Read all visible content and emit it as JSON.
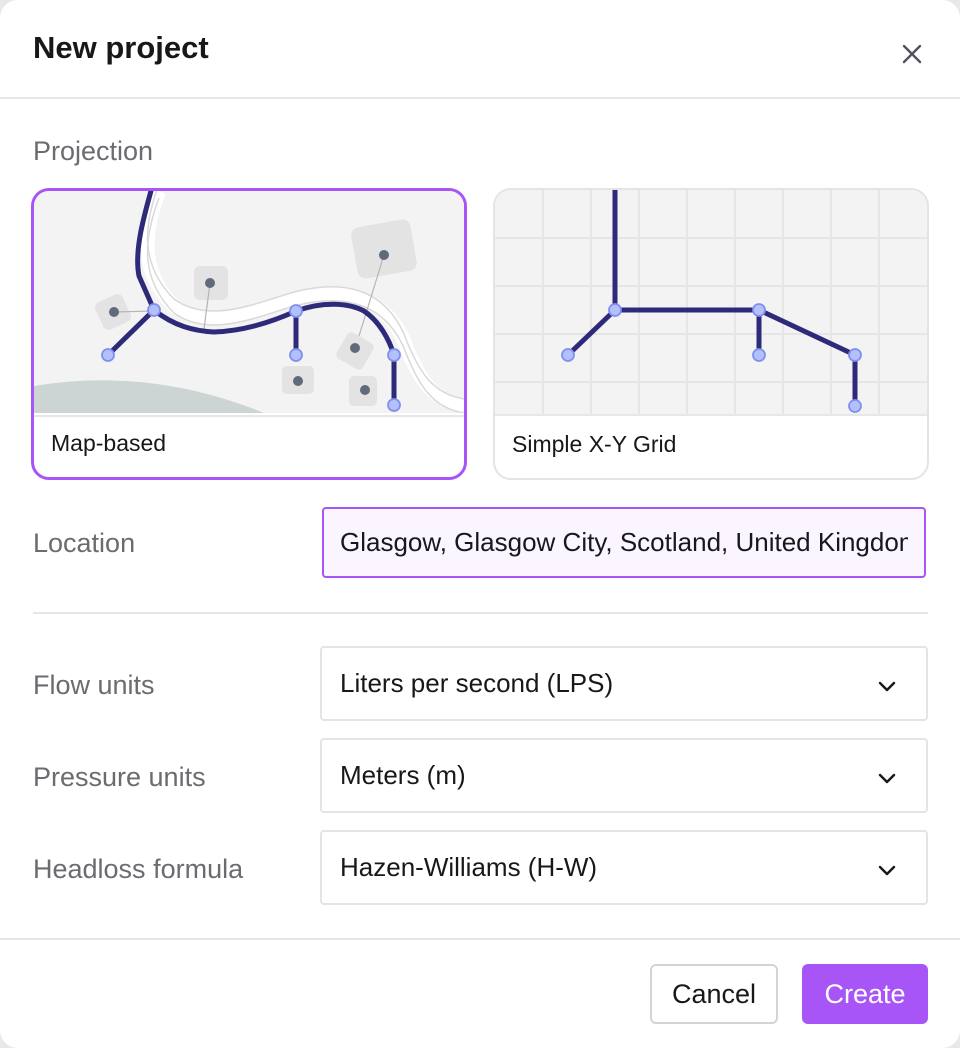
{
  "dialog": {
    "title": "New project",
    "close_icon": "close-icon"
  },
  "projection": {
    "label": "Projection",
    "options": [
      {
        "label": "Map-based",
        "selected": true
      },
      {
        "label": "Simple X-Y Grid",
        "selected": false
      }
    ]
  },
  "location": {
    "label": "Location",
    "value": "Glasgow, Glasgow City, Scotland, United Kingdom"
  },
  "flow_units": {
    "label": "Flow units",
    "value": "Liters per second (LPS)"
  },
  "pressure_units": {
    "label": "Pressure units",
    "value": "Meters (m)"
  },
  "headloss_formula": {
    "label": "Headloss formula",
    "value": "Hazen-Williams (H-W)"
  },
  "buttons": {
    "cancel": "Cancel",
    "create": "Create"
  },
  "colors": {
    "accent": "#a855f7",
    "pipe": "#2e2a7a",
    "node_fill": "#b4c0fb"
  }
}
